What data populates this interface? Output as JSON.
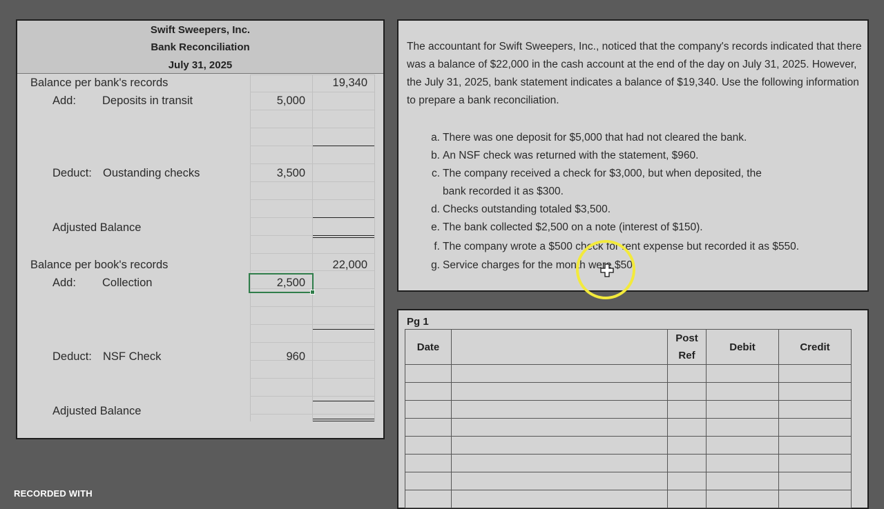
{
  "reconciliation": {
    "company": "Swift Sweepers, Inc.",
    "title": "Bank Reconciliation",
    "date": "July 31, 2025",
    "bank_side": {
      "label": "Balance per bank's records",
      "balance": "19,340",
      "add_label": "Add:",
      "add_item": "Deposits in transit",
      "add_amount": "5,000",
      "deduct_label": "Deduct:",
      "deduct_item": "Oustanding checks",
      "deduct_amount": "3,500",
      "adjusted_label": "Adjusted Balance"
    },
    "book_side": {
      "label": "Balance per book's records",
      "balance": "22,000",
      "add_label": "Add:",
      "add_item": "Collection",
      "add_amount": "2,500",
      "deduct_label": "Deduct:",
      "deduct_item": "NSF Check",
      "deduct_amount": "960",
      "adjusted_label": "Adjusted Balance"
    }
  },
  "problem": {
    "paragraph": "The accountant for Swift Sweepers, Inc., noticed that the company's records indicated that there was a balance of $22,000 in the cash account at the end of the day on July 31, 2025. However, the July 31, 2025, bank statement indicates a balance of $19,340. Use the following information to prepare a bank reconciliation.",
    "items": [
      {
        "letter": "a.",
        "text": "There was one deposit for $5,000 that had not cleared the bank."
      },
      {
        "letter": "b.",
        "text": "An NSF check was returned with the statement, $960."
      },
      {
        "letter": "c.",
        "text": "The company received a check for $3,000, but when deposited, the"
      },
      {
        "letter": "",
        "text": "bank recorded it as $300."
      },
      {
        "letter": "d.",
        "text": "Checks outstanding totaled $3,500."
      },
      {
        "letter": "e.",
        "text": "The bank collected $2,500 on a note (interest of $150)."
      },
      {
        "letter": "f.",
        "text": "The company wrote a $500 check for rent expense but recorded it as $550."
      },
      {
        "letter": "g.",
        "text": "Service charges for the month were $50."
      }
    ]
  },
  "journal": {
    "page_label": "Pg 1",
    "headers": {
      "date": "Date",
      "post_ref_line1": "Post",
      "post_ref_line2": "Ref",
      "debit": "Debit",
      "credit": "Credit"
    }
  },
  "watermark": "RECORDED WITH",
  "colors": {
    "background": "#5b5b5b",
    "panel": "#d4d4d4",
    "selection": "#2f7d4a",
    "cursor_highlight": "#f3ea3c"
  }
}
